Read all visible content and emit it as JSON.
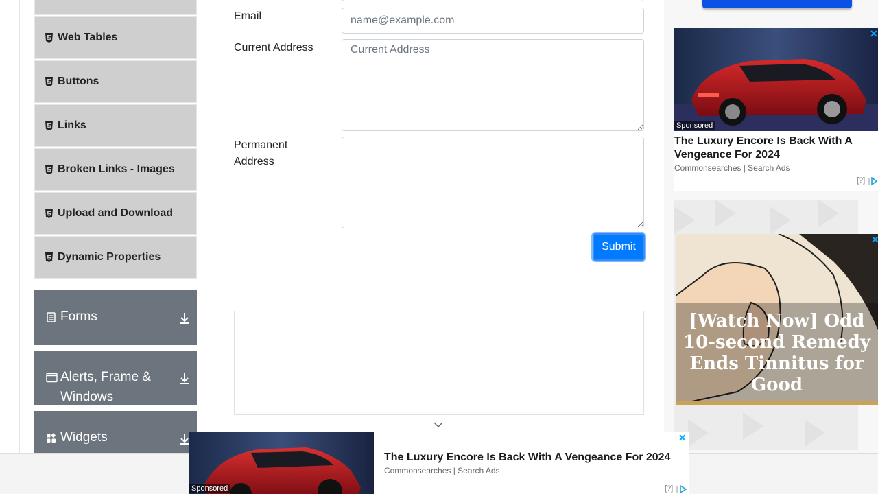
{
  "sidebar": {
    "items": [
      {
        "label": "Web Tables"
      },
      {
        "label": "Buttons"
      },
      {
        "label": "Links"
      },
      {
        "label": "Broken Links - Images"
      },
      {
        "label": "Upload and Download"
      },
      {
        "label": "Dynamic Properties"
      }
    ],
    "groups": [
      {
        "label": "Forms",
        "icon": "form-icon"
      },
      {
        "label_line1": "Alerts, Frame &",
        "label_line2": "Windows",
        "icon": "window-icon"
      },
      {
        "label": "Widgets",
        "icon": "widgets-icon"
      }
    ]
  },
  "form": {
    "email_label": "Email",
    "email_placeholder": "name@example.com",
    "current_address_label": "Current Address",
    "current_address_placeholder": "Current Address",
    "permanent_label_line1": "Permanent",
    "permanent_label_line2": "Address",
    "submit_label": "Submit"
  },
  "ads": {
    "ad1": {
      "sponsored": "Sponsored",
      "title": "The Luxury Encore Is Back With A Vengeance For 2024",
      "source": "Commonsearches | Search Ads",
      "meta": "[?]"
    },
    "ad2": {
      "headline": "[Watch Now] Odd 10-second Remedy Ends Tinnitus for Good"
    },
    "bottom": {
      "sponsored": "Sponsored",
      "title": "The Luxury Encore Is Back With A Vengeance For 2024",
      "source": "Commonsearches | Search Ads",
      "meta": "[?]"
    }
  },
  "colors": {
    "accent": "#007bff",
    "group_bg": "#6c757d",
    "item_bg": "#cfcfcf"
  }
}
